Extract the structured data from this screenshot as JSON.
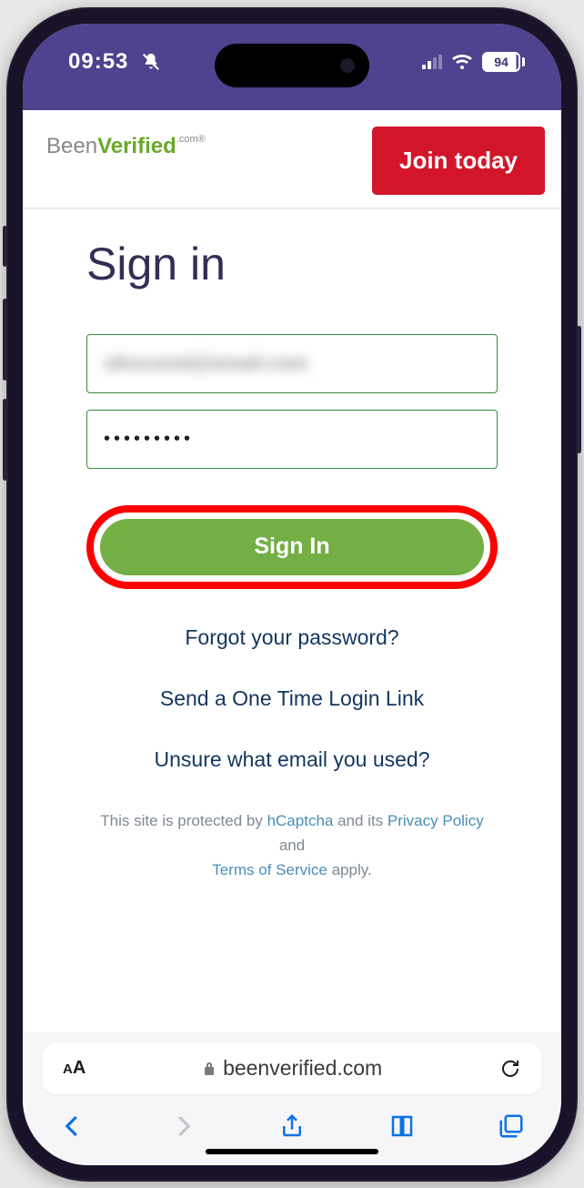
{
  "status": {
    "time": "09:53",
    "battery": "94"
  },
  "header": {
    "logo_prefix": "Been",
    "logo_suffix": "Verified",
    "logo_tiny": ".com®",
    "join_label": "Join today"
  },
  "form": {
    "title": "Sign in",
    "email_value": "obscured@email.com",
    "password_value": "•••••••••",
    "submit_label": "Sign In"
  },
  "links": {
    "forgot": "Forgot your password?",
    "onetime": "Send a One Time Login Link",
    "unsure": "Unsure what email you used?"
  },
  "legal": {
    "pre": "This site is protected by ",
    "hcaptcha": "hCaptcha",
    "mid": " and its ",
    "privacy": "Privacy Policy",
    "and": " and ",
    "tos": "Terms of Service",
    "apply": " apply."
  },
  "browser": {
    "url": "beenverified.com"
  }
}
